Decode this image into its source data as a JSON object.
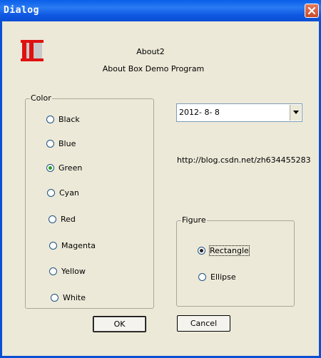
{
  "window": {
    "title": "Dialog"
  },
  "about": {
    "title": "About2",
    "subtitle": "About Box Demo Program"
  },
  "color_group": {
    "label": "Color",
    "options": [
      "Black",
      "Blue",
      "Green",
      "Cyan",
      "Red",
      "Magenta",
      "Yellow",
      "White"
    ],
    "selected": "Green"
  },
  "date_picker": {
    "value": "2012- 8- 8"
  },
  "url": "http://blog.csdn.net/zh634455283",
  "figure_group": {
    "label": "Figure",
    "options": [
      "Rectangle",
      "Ellipse"
    ],
    "selected": "Rectangle"
  },
  "buttons": {
    "ok": "OK",
    "cancel": "Cancel"
  },
  "icons": {
    "app": "app-logo-icon",
    "close": "close-icon",
    "dropdown": "chevron-down-icon"
  },
  "colors": {
    "titlebar": "#0a5ee8",
    "dialog_bg": "#ece9d8",
    "close": "#d9573a",
    "logo_red": "#e01010"
  }
}
